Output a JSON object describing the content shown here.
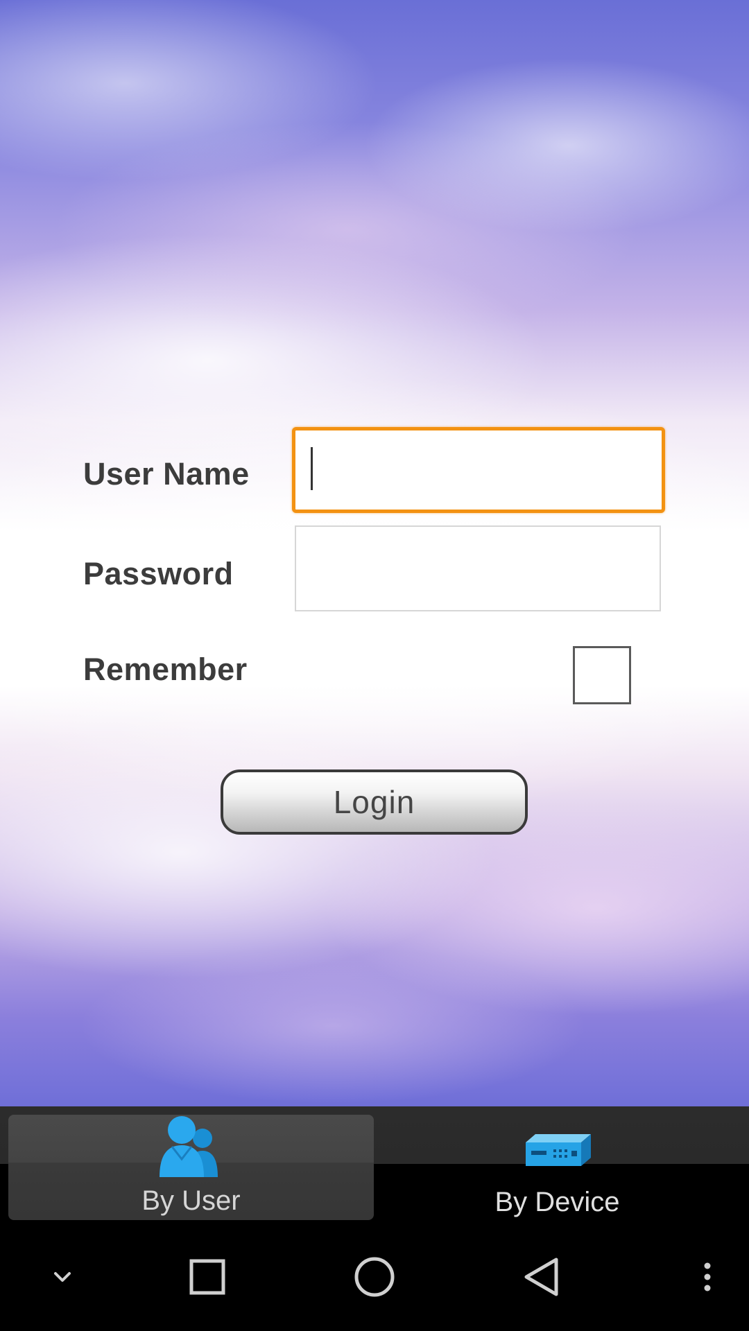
{
  "form": {
    "username_label": "User Name",
    "username_value": "",
    "password_label": "Password",
    "password_value": "",
    "remember_label": "Remember",
    "remember_checked": false,
    "login_label": "Login",
    "focus_color": "#f39212"
  },
  "tabs": [
    {
      "label": "By User",
      "icon": "users-icon",
      "selected": true
    },
    {
      "label": "By Device",
      "icon": "device-icon",
      "selected": false
    }
  ],
  "navbar": {
    "buttons": [
      "hide-keyboard-icon",
      "recents-icon",
      "home-icon",
      "back-icon",
      "menu-icon"
    ]
  },
  "colors": {
    "tab_icon_blue": "#1ea0e6",
    "tabbar_bg": "#2a2a2a"
  }
}
